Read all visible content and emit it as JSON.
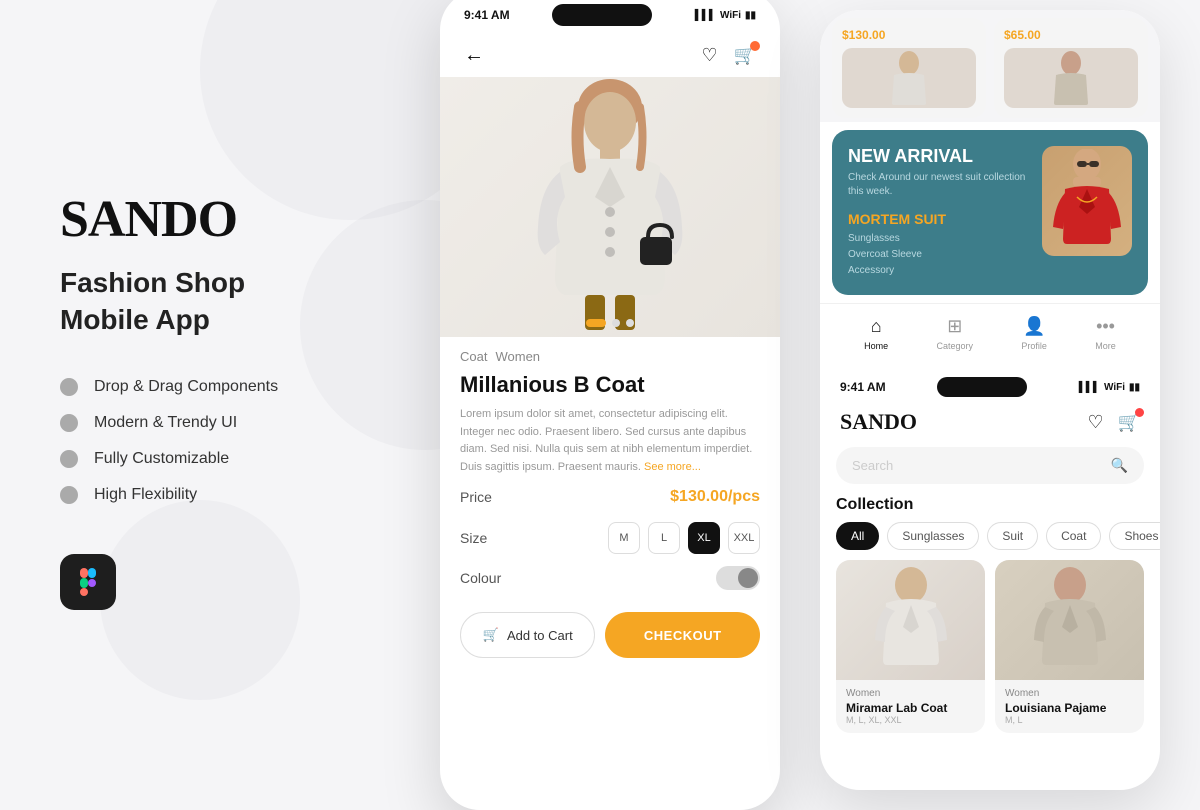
{
  "app": {
    "brand": "SANDO",
    "subtitle": "Fashion Shop\nMobile App"
  },
  "features": [
    {
      "label": "Drop & Drag Components"
    },
    {
      "label": "Modern & Trendy UI"
    },
    {
      "label": "Fully Customizable"
    },
    {
      "label": "High Flexibility"
    }
  ],
  "figma": {
    "label": "Figma Icon"
  },
  "phone_middle": {
    "status_time": "9:41 AM",
    "product_tags": [
      "Coat",
      "Women"
    ],
    "product_title": "Millanious B Coat",
    "product_desc": "Lorem ipsum dolor sit amet, consectetur adipiscing elit. Integer nec odio. Praesent libero. Sed cursus ante dapibus diam. Sed nisi. Nulla quis sem at nibh elementum imperdiet. Duis sagittis ipsum. Praesent mauris.",
    "see_more": "See more...",
    "price_label": "Price",
    "price_value": "$130.00/pcs",
    "size_label": "Size",
    "sizes": [
      "M",
      "L",
      "XL",
      "XXL"
    ],
    "active_size": "XL",
    "colour_label": "Colour",
    "btn_cart": "Add to Cart",
    "btn_checkout": "CHECKOUT"
  },
  "phone_right": {
    "status_time": "9:41 AM",
    "top_price_1": "$130.00",
    "top_price_2": "$65.00",
    "banner": {
      "tag": "NEW ARRIVAL",
      "subtitle": "Check Around our newest suit collection this week.",
      "product_name": "MORTEM SUIT",
      "details": [
        "Sunglasses",
        "Overcoat Sleeve",
        "Accessory"
      ]
    },
    "nav_items": [
      "Home",
      "Category",
      "Profile",
      "More"
    ],
    "brand": "SANDO",
    "search_placeholder": "Search",
    "collection_title": "Collection",
    "collection_tabs": [
      "All",
      "Sunglasses",
      "Suit",
      "Coat",
      "Shoes"
    ],
    "active_tab": "All",
    "products": [
      {
        "name": "Miramar Lab Coat",
        "type": "Women",
        "sizes": "M, L, XL, XXL"
      },
      {
        "name": "Louisiana Pajame",
        "type": "Women",
        "sizes": "M, L"
      }
    ]
  },
  "icons": {
    "back_arrow": "←",
    "heart": "♡",
    "cart": "🛒",
    "search": "🔍",
    "cart_symbol": "⊕",
    "home_icon": "⌂",
    "grid_icon": "⊞",
    "person_icon": "👤",
    "more_icon": "•••"
  }
}
